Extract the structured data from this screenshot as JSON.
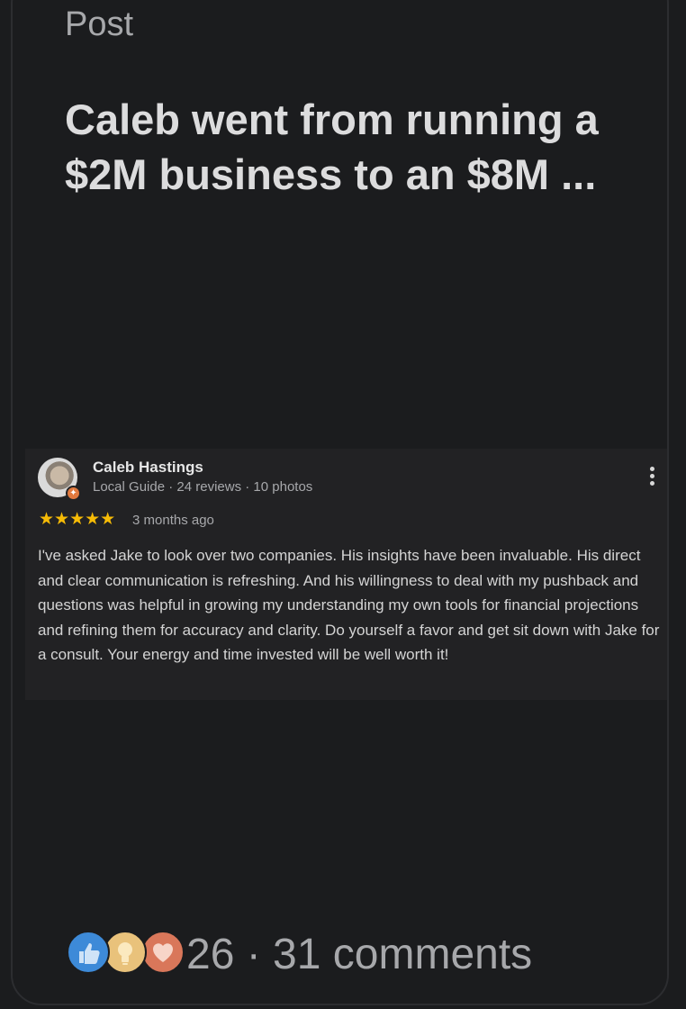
{
  "post": {
    "label": "Post",
    "title": "Caleb went from running a $2M business to an $8M ..."
  },
  "review": {
    "reviewer_name": "Caleb Hastings",
    "reviewer_meta": "Local Guide · 24 reviews · 10 photos",
    "rating": 5,
    "stars_text": "★★★★★",
    "time_ago": "3 months ago",
    "text": "I've asked Jake to look over two companies. His insights have been invaluable. His direct and clear communication is refreshing. And his willingness to deal with my pushback and questions was helpful in growing my understanding my own tools for financial projections and refining them for accuracy and clarity. Do yourself a favor and get sit down with Jake for a consult. Your energy and time invested will be well worth it!",
    "more_icon": "more-vert-icon",
    "badge_icon": "local-guide-badge-icon"
  },
  "engagement": {
    "reactions": [
      "like-icon",
      "insightful-icon",
      "love-icon"
    ],
    "summary": "26 · 31 comments"
  },
  "colors": {
    "background": "#1b1c1e",
    "review_background": "#222224",
    "star": "#f6bb06",
    "like": "#3d8ad8",
    "insightful": "#e9c27b",
    "love": "#d9775a"
  }
}
